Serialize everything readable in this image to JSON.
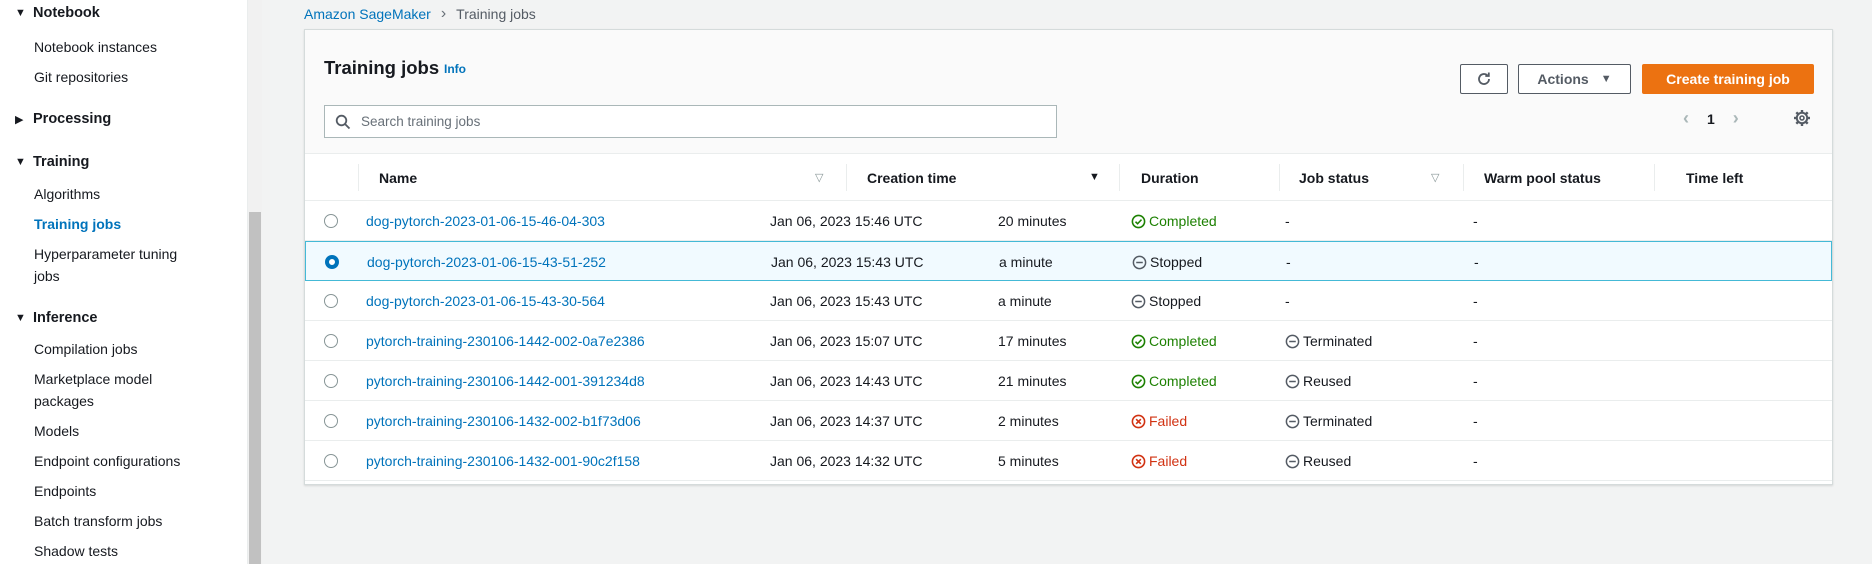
{
  "sidebar": {
    "notebook": {
      "label": "Notebook",
      "items": [
        "Notebook instances",
        "Git repositories"
      ]
    },
    "processing": {
      "label": "Processing"
    },
    "training": {
      "label": "Training",
      "items": [
        "Algorithms",
        "Training jobs",
        "Hyperparameter tuning",
        "jobs"
      ],
      "active": "Training jobs"
    },
    "inference": {
      "label": "Inference",
      "items": [
        "Compilation jobs",
        "Marketplace model",
        "packages",
        "Models",
        "Endpoint configurations",
        "Endpoints",
        "Batch transform jobs",
        "Shadow tests"
      ]
    }
  },
  "breadcrumb": {
    "root": "Amazon SageMaker",
    "current": "Training jobs"
  },
  "panel": {
    "title": "Training jobs",
    "info": "Info",
    "actions_label": "Actions",
    "create_label": "Create training job",
    "search_placeholder": "Search training jobs",
    "page_number": "1"
  },
  "table": {
    "columns": [
      "Name",
      "Creation time",
      "Duration",
      "Job status",
      "Warm pool status",
      "Time left"
    ],
    "rows": [
      {
        "name": "dog-pytorch-2023-01-06-15-46-04-303",
        "created": "Jan 06, 2023 15:46 UTC",
        "duration": "20 minutes",
        "status": "Completed",
        "warm_pool": "-",
        "time_left": "-"
      },
      {
        "name": "dog-pytorch-2023-01-06-15-43-51-252",
        "created": "Jan 06, 2023 15:43 UTC",
        "duration": "a minute",
        "status": "Stopped",
        "warm_pool": "-",
        "time_left": "-"
      },
      {
        "name": "dog-pytorch-2023-01-06-15-43-30-564",
        "created": "Jan 06, 2023 15:43 UTC",
        "duration": "a minute",
        "status": "Stopped",
        "warm_pool": "-",
        "time_left": "-"
      },
      {
        "name": "pytorch-training-230106-1442-002-0a7e2386",
        "created": "Jan 06, 2023 15:07 UTC",
        "duration": "17 minutes",
        "status": "Completed",
        "warm_pool": "Terminated",
        "time_left": "-"
      },
      {
        "name": "pytorch-training-230106-1442-001-391234d8",
        "created": "Jan 06, 2023 14:43 UTC",
        "duration": "21 minutes",
        "status": "Completed",
        "warm_pool": "Reused",
        "time_left": "-"
      },
      {
        "name": "pytorch-training-230106-1432-002-b1f73d06",
        "created": "Jan 06, 2023 14:37 UTC",
        "duration": "2 minutes",
        "status": "Failed",
        "warm_pool": "Terminated",
        "time_left": "-"
      },
      {
        "name": "pytorch-training-230106-1432-001-90c2f158",
        "created": "Jan 06, 2023 14:32 UTC",
        "duration": "5 minutes",
        "status": "Failed",
        "warm_pool": "Reused",
        "time_left": "-"
      }
    ],
    "selected_row": 1
  },
  "colors": {
    "accent": "#0073bb",
    "primary_button": "#ec7211",
    "completed": "#1d8102",
    "failed": "#d13212"
  },
  "icons": {
    "refresh": "refresh-icon",
    "search": "search-icon",
    "settings": "gear-icon",
    "completed": "check-circle-icon",
    "stopped": "minus-circle-icon",
    "failed": "x-circle-icon"
  }
}
